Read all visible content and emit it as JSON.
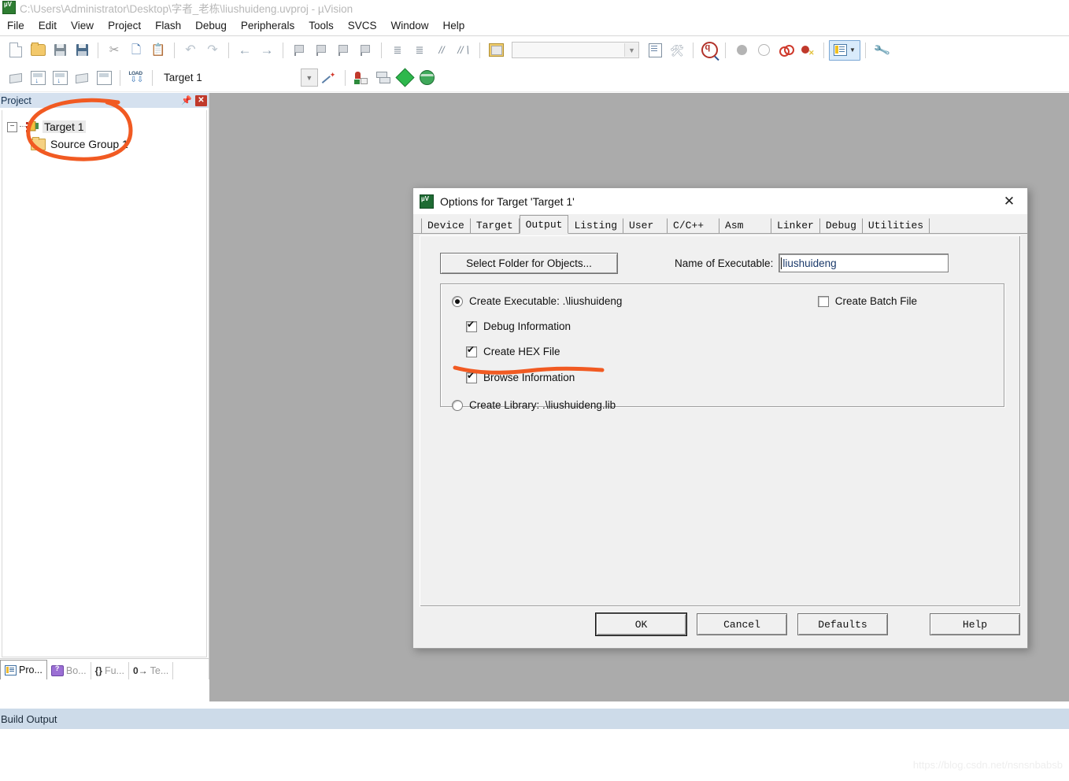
{
  "window": {
    "title": "C:\\Users\\Administrator\\Desktop\\字者_老栋\\liushuideng.uvproj - µVision",
    "app_icon": "uvision-icon"
  },
  "menubar": {
    "items": [
      {
        "label": "File"
      },
      {
        "label": "Edit"
      },
      {
        "label": "View"
      },
      {
        "label": "Project"
      },
      {
        "label": "Flash"
      },
      {
        "label": "Debug"
      },
      {
        "label": "Peripherals"
      },
      {
        "label": "Tools"
      },
      {
        "label": "SVCS"
      },
      {
        "label": "Window"
      },
      {
        "label": "Help"
      }
    ]
  },
  "toolbar_main": {
    "icons": [
      "new-file-icon",
      "open-file-icon",
      "save-icon",
      "save-all-icon",
      "cut-icon",
      "copy-icon",
      "paste-icon",
      "undo-icon",
      "redo-icon",
      "navigate-back-icon",
      "navigate-forward-icon",
      "bookmark-toggle-icon",
      "bookmark-prev-icon",
      "bookmark-next-icon",
      "bookmark-clear-icon",
      "indent-icon",
      "outdent-icon",
      "comment-icon",
      "uncomment-icon",
      "open-manual-icon"
    ],
    "search_combo_value": "",
    "search_icons": [
      "find-in-files-icon",
      "bind-icon"
    ],
    "find_icon": "find-magnifier-icon",
    "breakpoint_icons": [
      "insert-breakpoint-icon",
      "disable-breakpoint-icon",
      "kill-all-breakpoints-icon",
      "disable-all-breakpoints-icon"
    ],
    "panel_toggle_icon": "manage-windows-icon",
    "configure_icon": "configure-toolbar-wrench-icon"
  },
  "toolbar_build": {
    "icons": [
      "translate-icon",
      "build-icon",
      "rebuild-icon",
      "batch-build-icon",
      "stop-build-icon",
      "download-icon"
    ],
    "target_name": "Target 1",
    "target_dropdown_icon": "chevron-down-icon",
    "wizard_icon": "manage-project-items-icon",
    "right_icons": [
      "options-for-target-icon",
      "manage-multi-project-icon",
      "new-component-icon",
      "pack-installer-icon"
    ]
  },
  "project_panel": {
    "header_title": "Project",
    "pin_icon": "pin-icon",
    "close_icon": "close-icon",
    "tree": [
      {
        "label": "Target 1",
        "icon": "target-icon",
        "level": 0,
        "expanded": true,
        "selected": true
      },
      {
        "label": "Source Group 1",
        "icon": "folder-icon",
        "level": 1,
        "expanded": false,
        "selected": false
      }
    ],
    "tabs": [
      {
        "label": "Pro...",
        "icon": "project-icon",
        "active": true
      },
      {
        "label": "Bo...",
        "icon": "books-icon",
        "active": false
      },
      {
        "label": "Fu...",
        "icon": "functions-icon",
        "active": false
      },
      {
        "label": "Te...",
        "icon": "templates-icon",
        "active": false
      }
    ]
  },
  "build_output": {
    "title": "Build Output"
  },
  "watermark": {
    "text": "https://blog.csdn.net/nsnsnbabsb"
  },
  "dialog": {
    "title": "Options for Target 'Target 1'",
    "icon": "uvision-icon",
    "close_icon": "close-icon",
    "tabs": [
      {
        "label": "Device",
        "active": false
      },
      {
        "label": "Target",
        "active": false
      },
      {
        "label": "Output",
        "active": true
      },
      {
        "label": "Listing",
        "active": false
      },
      {
        "label": "User",
        "active": false
      },
      {
        "label": "C/C++",
        "active": false
      },
      {
        "label": "Asm",
        "active": false
      },
      {
        "label": "Linker",
        "active": false
      },
      {
        "label": "Debug",
        "active": false
      },
      {
        "label": "Utilities",
        "active": false
      }
    ],
    "select_folder_button": "Select Folder for Objects...",
    "name_of_executable_label": "Name of Executable:",
    "name_of_executable_value": "liushuideng",
    "options": {
      "create_executable_label": "Create Executable:  .\\liushuideng",
      "create_executable_checked": true,
      "debug_information_label": "Debug Information",
      "debug_information_checked": true,
      "create_hex_file_label": "Create HEX File",
      "create_hex_file_checked": true,
      "browse_information_label": "Browse Information",
      "browse_information_checked": true,
      "create_batch_file_label": "Create Batch File",
      "create_batch_file_checked": false,
      "create_library_label": "Create Library:  .\\liushuideng.lib",
      "create_library_checked": false
    },
    "buttons": {
      "ok": "OK",
      "cancel": "Cancel",
      "defaults": "Defaults",
      "help": "Help"
    }
  },
  "annotations": {
    "accent_color": "#F15A22",
    "circle_target": "hand-drawn circle around Target 1 / Source Group 1",
    "underline_hex": "hand-drawn underline under Create HEX File"
  }
}
